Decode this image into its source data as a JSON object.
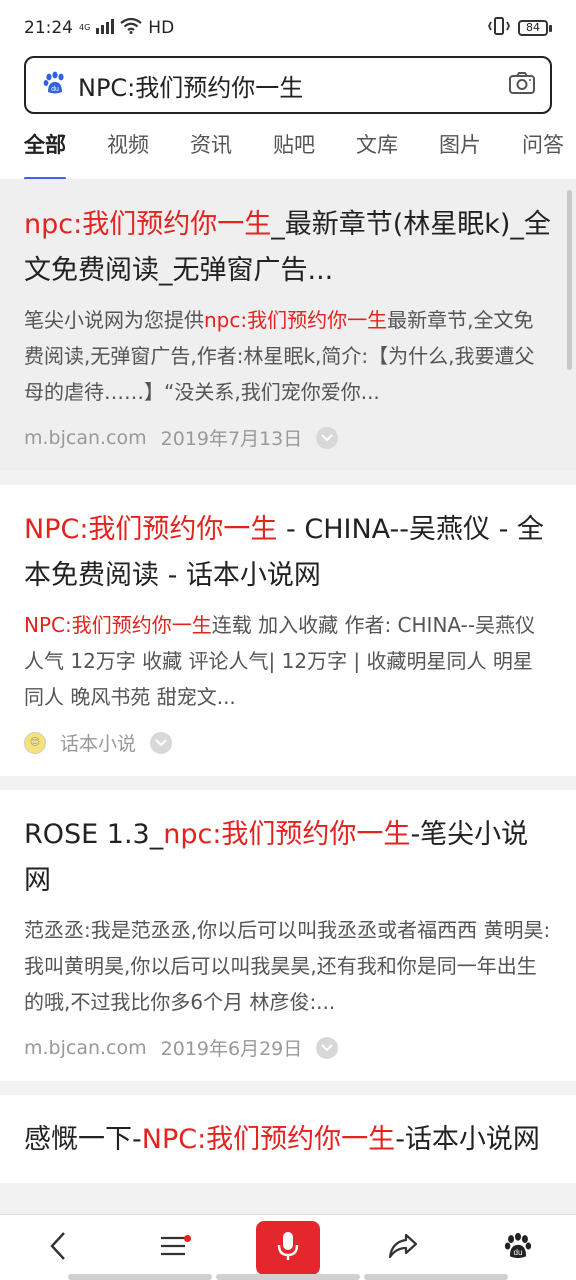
{
  "status_bar": {
    "time": "21:24",
    "network": "4G",
    "hd": "HD",
    "battery": "84"
  },
  "search": {
    "query": "NPC:我们预约你一生"
  },
  "tabs": [
    {
      "label": "全部",
      "active": true
    },
    {
      "label": "视频",
      "active": false
    },
    {
      "label": "资讯",
      "active": false
    },
    {
      "label": "贴吧",
      "active": false
    },
    {
      "label": "文库",
      "active": false
    },
    {
      "label": "图片",
      "active": false
    },
    {
      "label": "问答",
      "active": false
    }
  ],
  "results": [
    {
      "title_red": "npc:我们预约你一生",
      "title_rest": "_最新章节(林星眠k)_全文免费阅读_无弹窗广告...",
      "snippet_prefix": "笔尖小说网为您提供",
      "snippet_red": "npc:我们预约你一生",
      "snippet_rest": "最新章节,全文免费阅读,无弹窗广告,作者:林星眠k,简介:【为什么,我要遭父母的虐待……】“没关系,我们宠你爱你...",
      "source": "m.bjcan.com",
      "date": "2019年7月13日"
    },
    {
      "title_red": "NPC:我们预约你一生",
      "title_rest": " - CHINA--吴燕仪 - 全本免费阅读 - 话本小说网",
      "snippet_red": "NPC:我们预约你一生",
      "snippet_rest": "连载 加入收藏 作者: CHINA--吴燕仪 人气 12万字 收藏 评论人气| 12万字 | 收藏明星同人 明星同人 晚风书苑 甜宠文...",
      "source": "话本小说"
    },
    {
      "title_prefix": "ROSE 1.3_",
      "title_red": "npc:我们预约你一生",
      "title_rest": "-笔尖小说网",
      "snippet": "范丞丞:我是范丞丞,你以后可以叫我丞丞或者福西西 黄明昊:我叫黄明昊,你以后可以叫我昊昊,还有我和你是同一年出生的哦,不过我比你多6个月 林彦俊:...",
      "source": "m.bjcan.com",
      "date": "2019年6月29日"
    },
    {
      "title_prefix": "感慨一下-",
      "title_red": "NPC:我们预约你一生",
      "title_rest": "-话本小说网"
    }
  ],
  "icons": {
    "search_logo": "baidu-paw-icon",
    "camera": "camera-icon",
    "back": "back-arrow-icon",
    "menu": "menu-icon",
    "mic": "microphone-icon",
    "share": "share-icon",
    "home": "baidu-home-icon"
  },
  "colors": {
    "accent_blue": "#3a6bd9",
    "highlight_red": "#e4231f",
    "mic_red": "#e4272c"
  }
}
